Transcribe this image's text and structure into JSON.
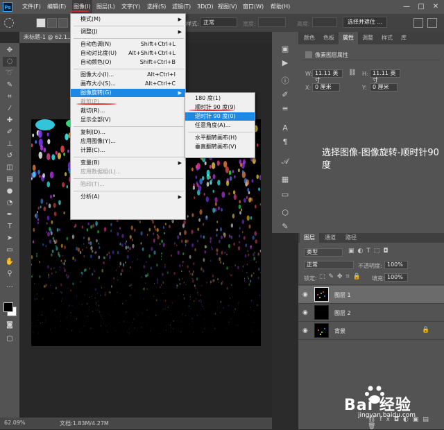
{
  "app": {
    "logo_text": "Ps"
  },
  "menubar": {
    "items": [
      "文件(F)",
      "编辑(E)",
      "图像(I)",
      "图层(L)",
      "文字(Y)",
      "选择(S)",
      "滤镜(T)",
      "3D(D)",
      "视图(V)",
      "窗口(W)",
      "帮助(H)"
    ],
    "window_controls": [
      "—",
      "□",
      "✕"
    ]
  },
  "options_bar": {
    "style_label": "样式:",
    "style_value": "正常",
    "width_label": "宽度:",
    "height_label": "高度:",
    "select_mask_button": "选择并遮住 ..."
  },
  "document": {
    "tab_title": "未标题-1 @ 62.1..."
  },
  "status": {
    "zoom": "62.09%",
    "doc_info": "文档:1.83M/4.27M"
  },
  "image_menu": {
    "items": [
      {
        "label": "模式(M)",
        "shortcut": "",
        "submenu": true,
        "disabled": false
      },
      {
        "sep": true
      },
      {
        "label": "调整(J)",
        "shortcut": "",
        "submenu": true,
        "disabled": false
      },
      {
        "sep": true
      },
      {
        "label": "自动色调(N)",
        "shortcut": "Shift+Ctrl+L",
        "disabled": false
      },
      {
        "label": "自动对比度(U)",
        "shortcut": "Alt+Shift+Ctrl+L",
        "disabled": false
      },
      {
        "label": "自动颜色(O)",
        "shortcut": "Shift+Ctrl+B",
        "disabled": false
      },
      {
        "sep": true
      },
      {
        "label": "图像大小(I)...",
        "shortcut": "Alt+Ctrl+I",
        "disabled": false
      },
      {
        "label": "画布大小(S)...",
        "shortcut": "Alt+Ctrl+C",
        "disabled": false
      },
      {
        "label": "图像旋转(G)",
        "shortcut": "",
        "submenu": true,
        "disabled": false,
        "highlighted": true
      },
      {
        "label": "裁剪(P)",
        "shortcut": "",
        "disabled": true
      },
      {
        "label": "裁切(R)...",
        "shortcut": "",
        "disabled": false
      },
      {
        "label": "显示全部(V)",
        "shortcut": "",
        "disabled": false
      },
      {
        "sep": true
      },
      {
        "label": "复制(D)...",
        "shortcut": "",
        "disabled": false
      },
      {
        "label": "应用图像(Y)...",
        "shortcut": "",
        "disabled": false
      },
      {
        "label": "计算(C)...",
        "shortcut": "",
        "disabled": false
      },
      {
        "sep": true
      },
      {
        "label": "变量(B)",
        "shortcut": "",
        "submenu": true,
        "disabled": false
      },
      {
        "label": "应用数据组(L)...",
        "shortcut": "",
        "disabled": true
      },
      {
        "sep": true
      },
      {
        "label": "陷印(T)...",
        "shortcut": "",
        "disabled": true
      },
      {
        "sep": true
      },
      {
        "label": "分析(A)",
        "shortcut": "",
        "submenu": true,
        "disabled": false
      }
    ]
  },
  "rotate_submenu": {
    "items": [
      {
        "label": "180 度(1)"
      },
      {
        "label": "顺时针 90 度(9)"
      },
      {
        "label": "逆时针 90 度(0)",
        "highlighted": true
      },
      {
        "label": "任意角度(A)..."
      },
      {
        "sep": true
      },
      {
        "label": "水平翻转画布(H)"
      },
      {
        "label": "垂直翻转画布(V)"
      }
    ]
  },
  "properties_panel": {
    "tabs": [
      "颜色",
      "色板",
      "属性",
      "调整",
      "样式",
      "库"
    ],
    "active_tab": "属性",
    "title": "像素图层属性",
    "w_label": "W:",
    "w_value": "11.11 英寸",
    "h_label": "H:",
    "h_value": "11.11 英寸",
    "x_label": "X:",
    "x_value": "0 厘米",
    "y_label": "Y:",
    "y_value": "0 厘米"
  },
  "annotation": {
    "text": "选择图像-图像旋转-顺时针90度"
  },
  "layers_panel": {
    "tabs": [
      "图层",
      "通道",
      "路径"
    ],
    "kind_filter": "类型",
    "blend_mode": "正常",
    "opacity_label": "不透明度:",
    "opacity_value": "100%",
    "lock_label": "锁定:",
    "fill_label": "填充:",
    "fill_value": "100%",
    "layers": [
      {
        "name": "图层 1",
        "selected": true
      },
      {
        "name": "图层 2",
        "selected": false
      },
      {
        "name": "背景",
        "selected": false,
        "locked": true
      }
    ]
  },
  "watermark": {
    "brand": "Bai 经验",
    "url": "jingyan.baidu.com"
  }
}
